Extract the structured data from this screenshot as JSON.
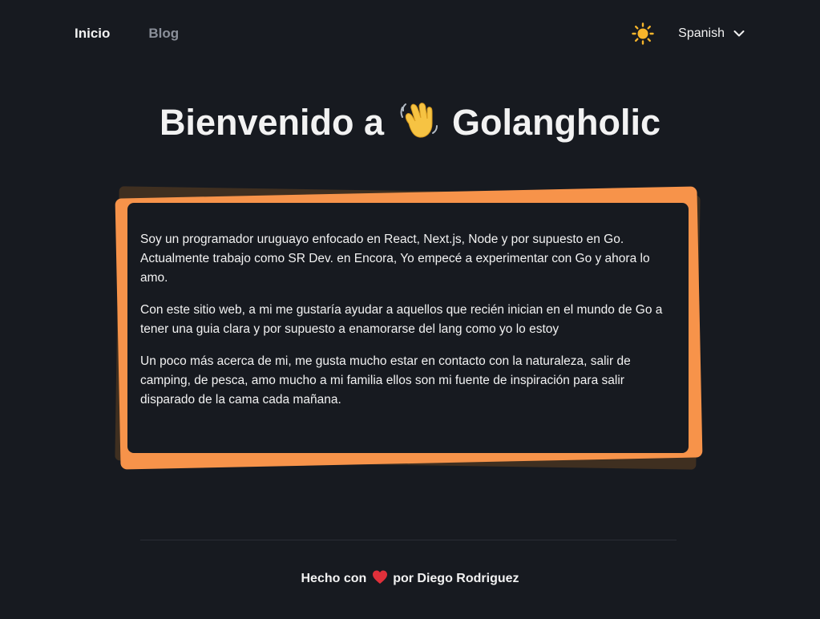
{
  "nav": {
    "links": [
      {
        "label": "Inicio",
        "active": true
      },
      {
        "label": "Blog",
        "active": false
      }
    ],
    "theme_toggle_icon": "sun-icon",
    "language": {
      "selected": "Spanish",
      "icon": "chevron-down-icon"
    }
  },
  "hero": {
    "title_before": "Bienvenido a",
    "title_icon": "waving-hand-icon",
    "title_after": "Golangholic"
  },
  "about": {
    "paragraphs": [
      "Soy un programador uruguayo enfocado en React, Next.js, Node y por supuesto en Go. Actualmente trabajo como SR Dev. en Encora, Yo empecé a experimentar con Go y ahora lo amo.",
      "Con este sitio web, a mi me gustaría ayudar a aquellos que recién inician en el mundo de Go a tener una guia clara y por supuesto a enamorarse del lang como yo lo estoy",
      "Un poco más acerca de mi, me gusta mucho estar en contacto con la naturaleza, salir de camping, de pesca, amo mucho a mi familia ellos son mi fuente de inspiración para salir disparado de la cama cada mañana."
    ]
  },
  "footer": {
    "text_before": "Hecho con",
    "icon": "heart-icon",
    "text_after": "por Diego Rodriguez"
  },
  "colors": {
    "background": "#171a20",
    "accent": "#f7934a",
    "text": "#f2f2f2",
    "muted": "#8a8f99"
  }
}
